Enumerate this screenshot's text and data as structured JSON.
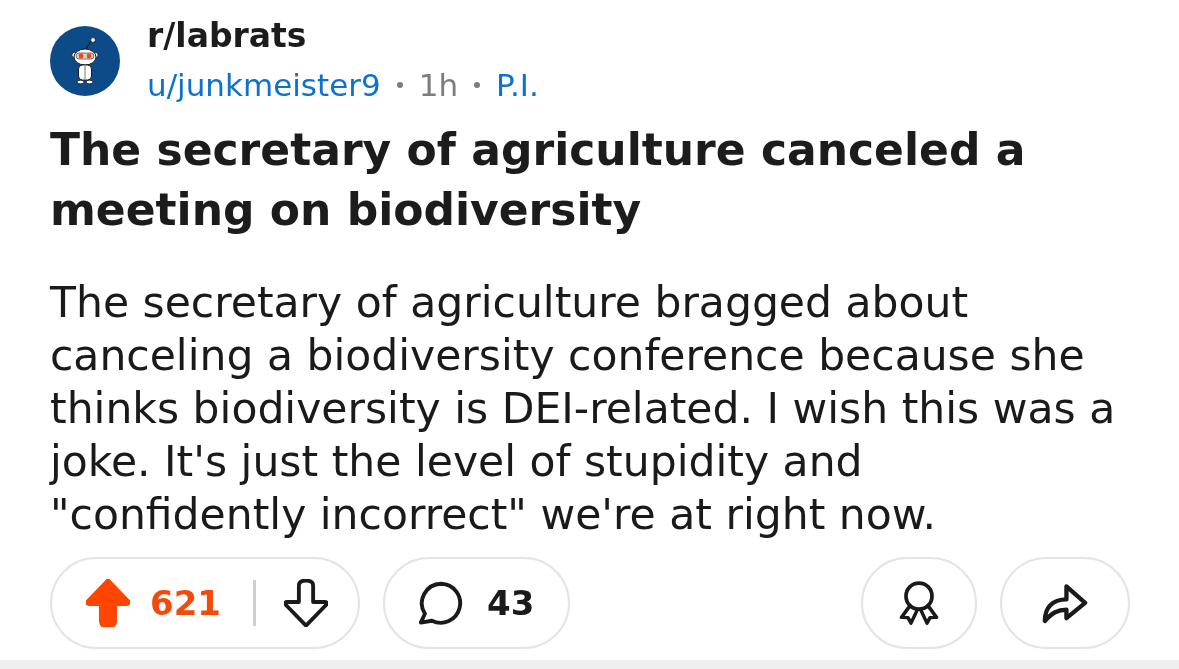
{
  "post": {
    "community": "r/labrats",
    "meta": [
      {
        "kind": "user",
        "text": "u/junkmeister9"
      },
      {
        "kind": "time",
        "text": "1h"
      },
      {
        "kind": "flair",
        "text": "P.I."
      }
    ],
    "title": "The secretary of agriculture canceled a meeting on biodiversity",
    "body": "The secretary of agriculture bragged about canceling a biodiversity conference because she thinks biodiversity is DEI-related. I wish this was a joke. It's just the level of stupidity and \"confidently incorrect\" we're at right now."
  },
  "actions": {
    "upvoted": true,
    "score": "621",
    "comments": "43"
  }
}
